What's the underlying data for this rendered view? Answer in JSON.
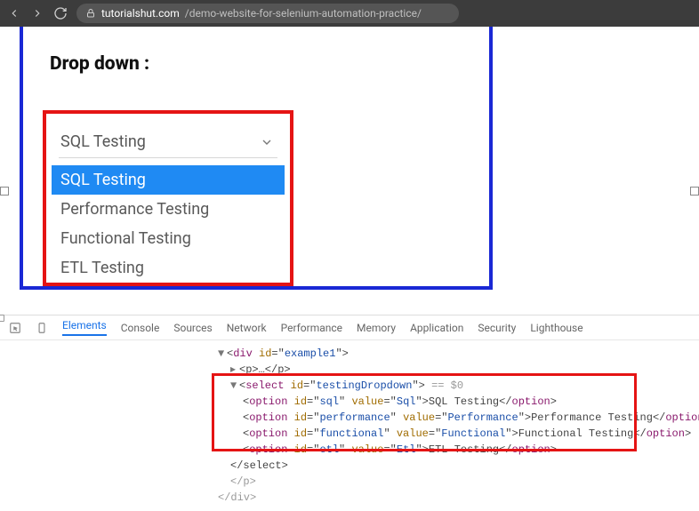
{
  "browser": {
    "url_host": "tutorialshut.com",
    "url_path": "/demo-website-for-selenium-automation-practice/"
  },
  "page": {
    "heading": "Drop down :",
    "dropdown": {
      "selected_label": "SQL Testing",
      "options": [
        {
          "label": "SQL Testing",
          "selected": true
        },
        {
          "label": "Performance Testing",
          "selected": false
        },
        {
          "label": "Functional Testing",
          "selected": false
        },
        {
          "label": "ETL Testing",
          "selected": false
        }
      ]
    }
  },
  "devtools": {
    "tabs": [
      "Elements",
      "Console",
      "Sources",
      "Network",
      "Performance",
      "Memory",
      "Application",
      "Security",
      "Lighthouse"
    ],
    "active_tab": "Elements",
    "dom": {
      "wrapper_id": "example1",
      "p_placeholder": "<p>…</p>",
      "select_id": "testingDropdown",
      "eq0": "== $0",
      "options": [
        {
          "id": "sql",
          "value": "Sql",
          "text": "SQL Testing"
        },
        {
          "id": "performance",
          "value": "Performance",
          "text": "Performance Testing"
        },
        {
          "id": "functional",
          "value": "Functional",
          "text": "Functional Testing"
        },
        {
          "id": "etl",
          "value": "Etl",
          "text": "ETL Testing"
        }
      ],
      "close_select": "</select>",
      "close_p": "</p>",
      "close_div": "</div>"
    }
  }
}
